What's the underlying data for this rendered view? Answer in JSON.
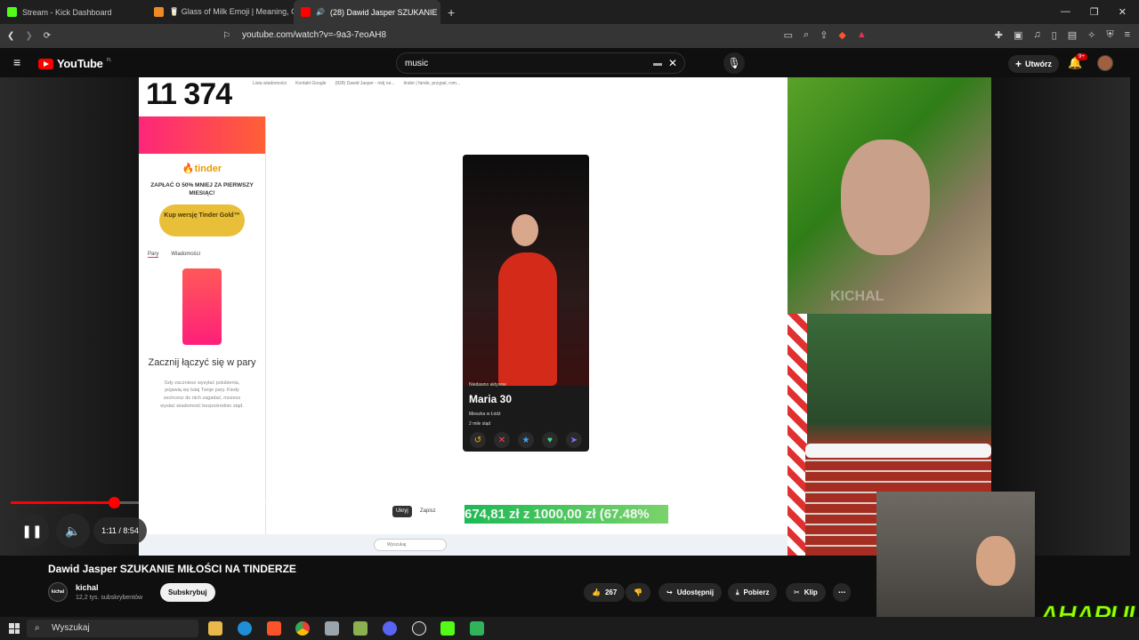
{
  "browser": {
    "tabs": [
      {
        "title": "Stream - Kick Dashboard",
        "active": false
      },
      {
        "title": "🥛 Glass of Milk Emoji | Meaning, Co",
        "active": false
      },
      {
        "title": "(28) Dawid Jasper SZUKANIE",
        "active": true
      }
    ],
    "new_tab": "+",
    "url": "youtube.com/watch?v=-9a3-7eoAH8",
    "window_controls": [
      "—",
      "❐",
      "✕"
    ]
  },
  "youtube": {
    "logo_text": "YouTube",
    "region": "PL",
    "search_value": "music",
    "create_label": "Utwórz",
    "notif_badge": "9+",
    "player": {
      "current_time": "1:11",
      "duration": "8:54",
      "time_display": "1:11 / 8:54",
      "progress": 0.133
    },
    "video": {
      "title": "Dawid Jasper SZUKANIE MIŁOŚCI NA TINDERZE",
      "channel": "kichal",
      "channel_avatar_text": "kichal",
      "subscribers": "12,2 tys. subskrybentów",
      "subscribe_label": "Subskrybuj",
      "likes": "267",
      "share_label": "Udostępnij",
      "download_label": "Pobierz",
      "clip_label": "Klip"
    }
  },
  "video_content": {
    "counter": "11 374",
    "mini_tabs": [
      "Lista wiadomości",
      "Kontakt Google",
      "(828) Dawid Jasper - mój ne...",
      "tinder | fande, przypal, rom..."
    ],
    "tinder": {
      "logo": "tinder",
      "promo": "ZAPŁAĆ O 50% MNIEJ ZA PIERWSZY MIESIĄC!",
      "gold_button": "Kup wersję Tinder Gold™",
      "tab_pairs": "Pary",
      "tab_messages": "Wiadomości",
      "empty_title": "Zacznij łączyć się w pary",
      "empty_text": "Gdy zaczniesz wysyłać polubienia, pojawią się tutaj Twoje pary. Kiedy zechcesz do nich zagadać, możesz wysłać wiadomość bezpośrednio stąd."
    },
    "profile": {
      "active": "Niedawno aktywne",
      "name": "Maria 30",
      "city": "Mieszka w Łódź",
      "distance": "2 mile stąd"
    },
    "overlay_money": "674,81 zł z 1000,00 zł (67.48%",
    "overlay_buttons": [
      "Ukryj",
      "Zapisz"
    ],
    "mini_taskbar_search": "Wyszukaj",
    "watermark": "KICHAL",
    "streamer_logo": "AHAPULCO"
  },
  "taskbar": {
    "search_placeholder": "Wyszukaj"
  },
  "colors": {
    "yt_red": "#ff0000",
    "tinder_gradient_start": "#fd267a",
    "tinder_gradient_end": "#ff6036",
    "gold": "#e9bf3a",
    "overlay_green": "#1db954"
  }
}
